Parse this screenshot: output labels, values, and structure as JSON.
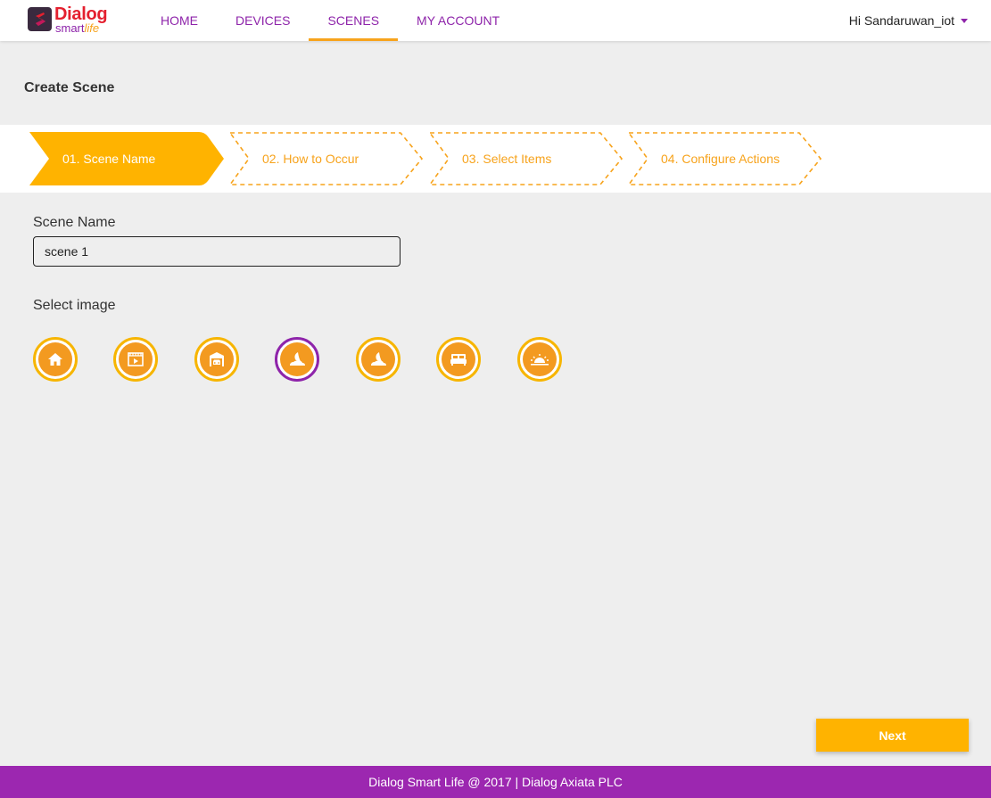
{
  "app": {
    "brand": "Dialog",
    "brand_sub_a": "smart",
    "brand_sub_b": "life",
    "colors": {
      "primary": "#8e24aa",
      "accent": "#f7a31c",
      "button": "#ffb300",
      "footer": "#9c27b0",
      "brand_red": "#e4202f"
    }
  },
  "nav": {
    "items": [
      {
        "label": "HOME",
        "active": false
      },
      {
        "label": "DEVICES",
        "active": false
      },
      {
        "label": "SCENES",
        "active": true
      },
      {
        "label": "MY ACCOUNT",
        "active": false
      }
    ],
    "user_greeting": "Hi Sandaruwan_iot"
  },
  "page": {
    "title": "Create Scene"
  },
  "stepper": {
    "steps": [
      {
        "label": "01. Scene Name",
        "state": "active"
      },
      {
        "label": "02. How to Occur",
        "state": "pending"
      },
      {
        "label": "03. Select Items",
        "state": "pending"
      },
      {
        "label": "04. Configure Actions",
        "state": "pending"
      }
    ]
  },
  "form": {
    "scene_name_label": "Scene Name",
    "scene_name_value": "scene 1",
    "select_image_label": "Select image",
    "images": [
      {
        "icon": "home-icon",
        "selected": false
      },
      {
        "icon": "movie-icon",
        "selected": false
      },
      {
        "icon": "garage-icon",
        "selected": false
      },
      {
        "icon": "night-icon",
        "selected": true
      },
      {
        "icon": "night-icon",
        "selected": false
      },
      {
        "icon": "bed-icon",
        "selected": false
      },
      {
        "icon": "sunrise-icon",
        "selected": false
      }
    ]
  },
  "actions": {
    "next_label": "Next"
  },
  "footer": {
    "text": "Dialog Smart Life @ 2017 | Dialog Axiata PLC"
  }
}
